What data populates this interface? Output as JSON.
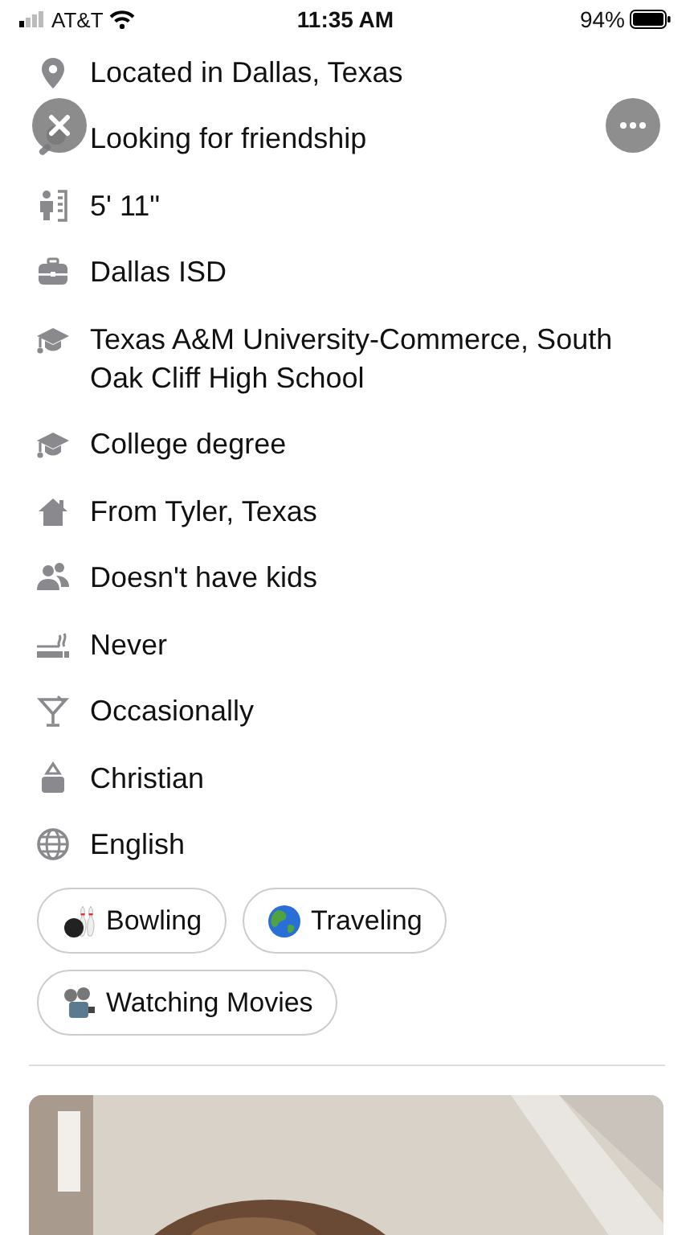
{
  "status_bar": {
    "carrier": "AT&T",
    "time": "11:35 AM",
    "battery": "94%"
  },
  "details": [
    {
      "kind": "location",
      "text": "Located in Dallas, Texas"
    },
    {
      "kind": "search",
      "text": "Looking for friendship"
    },
    {
      "kind": "height",
      "text": "5' 11\""
    },
    {
      "kind": "work",
      "text": "Dallas ISD"
    },
    {
      "kind": "school",
      "text": "Texas A&M University-Commerce, South Oak Cliff High School"
    },
    {
      "kind": "school",
      "text": "College degree"
    },
    {
      "kind": "home",
      "text": "From Tyler, Texas"
    },
    {
      "kind": "kids",
      "text": "Doesn't have kids"
    },
    {
      "kind": "smoking",
      "text": "Never"
    },
    {
      "kind": "drinking",
      "text": "Occasionally"
    },
    {
      "kind": "religion",
      "text": "Christian"
    },
    {
      "kind": "language",
      "text": "English"
    }
  ],
  "interests": [
    {
      "kind": "bowling",
      "label": "Bowling"
    },
    {
      "kind": "globe",
      "label": "Traveling"
    },
    {
      "kind": "projector",
      "label": "Watching Movies"
    }
  ]
}
